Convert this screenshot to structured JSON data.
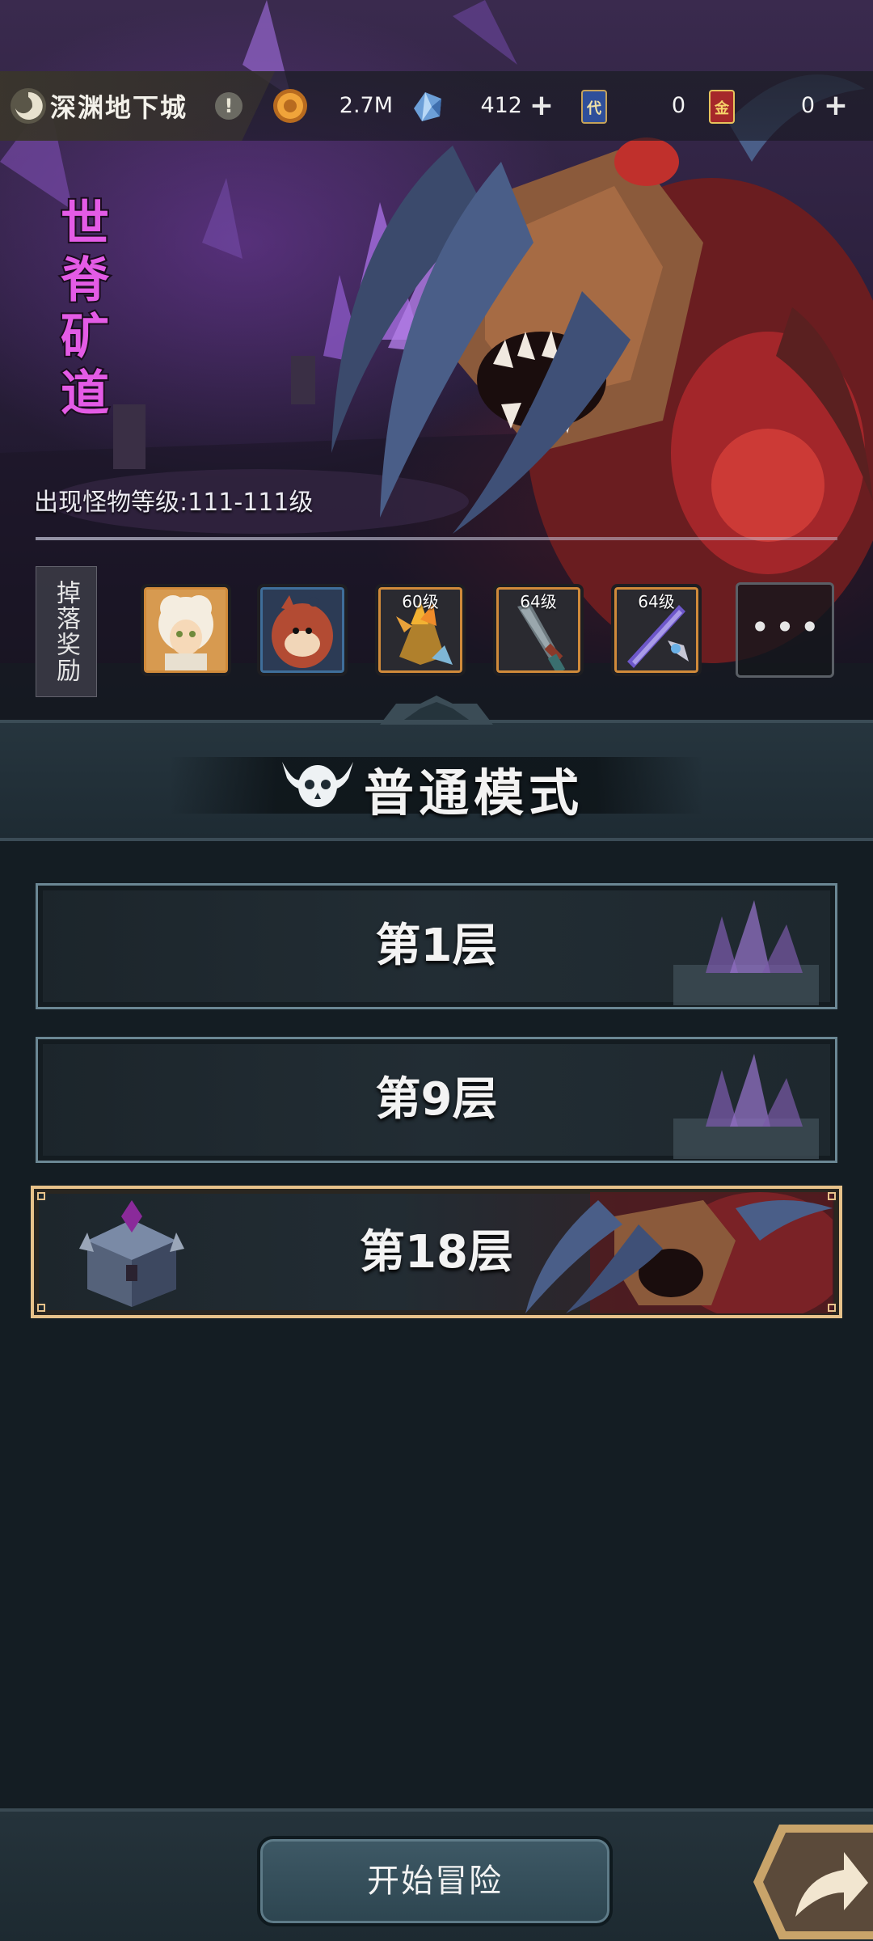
{
  "topbar": {
    "game_title": "深渊地下城",
    "info_glyph": "!",
    "resources": [
      {
        "icon": "coin-icon",
        "value": "2.7M",
        "has_plus": false
      },
      {
        "icon": "crystal-gem-icon",
        "value": "412",
        "has_plus": true
      },
      {
        "icon": "blue-ticket-card-icon",
        "value": "0",
        "has_plus": false
      },
      {
        "icon": "gold-ticket-card-icon",
        "value": "0",
        "has_plus": true
      }
    ],
    "plus_glyph": "+"
  },
  "dungeon": {
    "banner_name": "世脊矿道",
    "monster_level": "出现怪物等级:111-111级",
    "drop_label": "掉落奖励",
    "drops": [
      {
        "icon": "white-haired-hero-portrait-icon",
        "level": ""
      },
      {
        "icon": "red-blob-pet-icon",
        "level": ""
      },
      {
        "icon": "flame-claw-gauntlet-icon",
        "level": "60级"
      },
      {
        "icon": "dark-dagger-icon",
        "level": "64级"
      },
      {
        "icon": "purple-sword-icon",
        "level": "64级"
      }
    ],
    "more_glyph": "•••"
  },
  "mode": {
    "title": "普通模式",
    "icon": "horned-skull-icon"
  },
  "floors": [
    {
      "label": "第1层",
      "selected": false
    },
    {
      "label": "第9层",
      "selected": false
    },
    {
      "label": "第18层",
      "selected": true
    }
  ],
  "actions": {
    "start_label": "开始冒险",
    "share_icon": "share-arrow-icon"
  },
  "colors": {
    "selected_border": "#e7c28a",
    "floor_border": "#6b8794",
    "background": "#141d23"
  }
}
